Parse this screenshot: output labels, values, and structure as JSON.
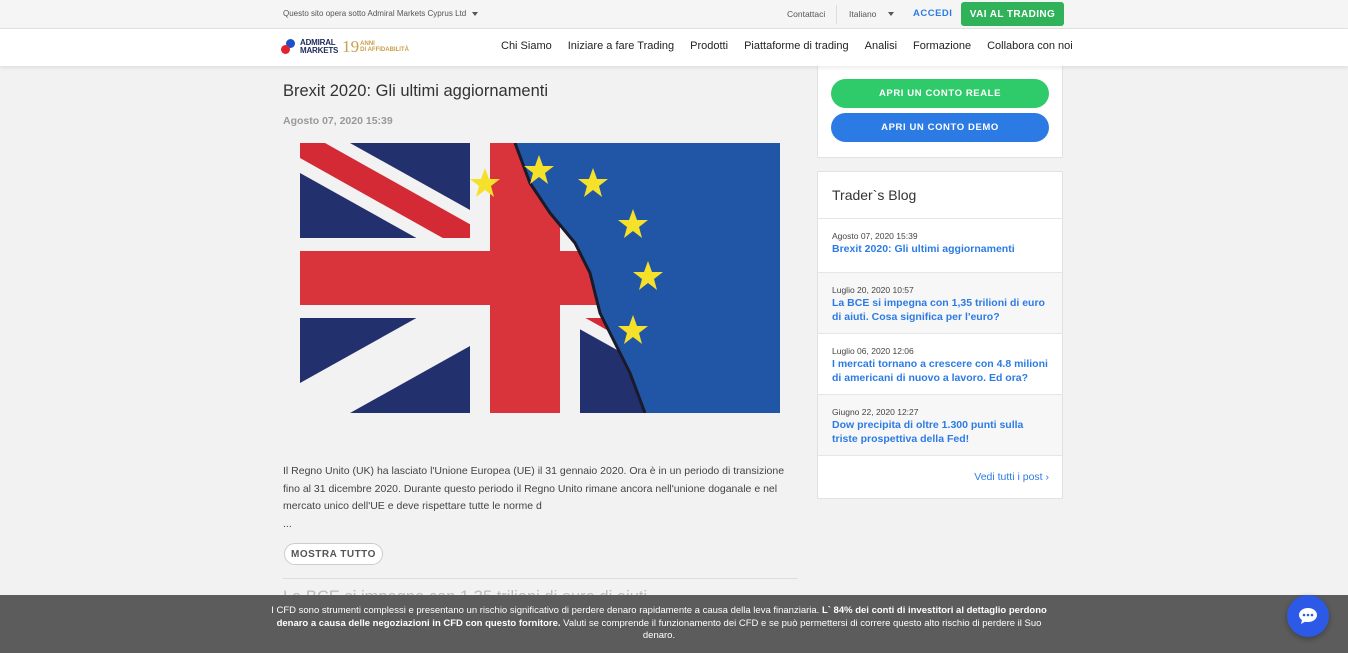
{
  "topbar": {
    "entity": "Questo sito opera sotto Admiral Markets Cyprus Ltd",
    "contact": "Contattaci",
    "language": "Italiano",
    "login": "ACCEDI",
    "trade_button": "VAI AL TRADING"
  },
  "logo": {
    "line1": "ADMIRAL",
    "line2": "MARKETS",
    "years": "19",
    "anni1": "ANNI",
    "anni2": "DI AFFIDABILITÀ"
  },
  "nav": {
    "items": [
      "Chi Siamo",
      "Iniziare a fare Trading",
      "Prodotti",
      "Piattaforme di trading",
      "Analisi",
      "Formazione",
      "Collabora con noi"
    ]
  },
  "article": {
    "title": "Brexit 2020: Gli ultimi aggiornamenti",
    "date": "Agosto 07, 2020 15:39",
    "body": "Il Regno Unito (UK) ha lasciato l'Unione Europea (UE) il 31 gennaio 2020. Ora è in un periodo di transizione fino al 31 dicembre 2020. Durante questo periodo il Regno Unito rimane ancora nell'unione doganale e nel mercato unico dell'UE e deve rispettare tutte le norme d",
    "ellipsis": "...",
    "show_all": "MOSTRA TUTTO",
    "next_title_partial": "La BCE si impegna con 1,35 trilioni di euro di aiuti"
  },
  "sidebar": {
    "cta_real": "APRI UN CONTO REALE",
    "cta_demo": "APRI UN CONTO DEMO",
    "blog_title": "Trader`s Blog",
    "blog_items": [
      {
        "date": "Agosto 07, 2020 15:39",
        "title": "Brexit 2020: Gli ultimi aggiornamenti"
      },
      {
        "date": "Luglio 20, 2020 10:57",
        "title": "La BCE si impegna con 1,35 trilioni di euro di aiuti. Cosa significa per l'euro?"
      },
      {
        "date": "Luglio 06, 2020 12:06",
        "title": "I mercati tornano a crescere con 4.8 milioni di americani di nuovo a lavoro. Ed ora?"
      },
      {
        "date": "Giugno 22, 2020 12:27",
        "title": "Dow precipita di oltre 1.300 punti sulla triste prospettiva della Fed!"
      }
    ],
    "blog_all": "Vedi tutti i post ›"
  },
  "risk": {
    "part1": "I CFD sono strumenti complessi e presentano un rischio significativo di perdere denaro rapidamente a causa della leva finanziaria. ",
    "part2_bold": "L` 84% dei conti di investitori al dettaglio perdono denaro a causa delle negoziazioni in CFD con questo fornitore.",
    "part3": " Valuti se comprende il funzionamento dei CFD e se può permettersi di correre questo alto rischio di perdere il Suo denaro."
  },
  "colors": {
    "green": "#2fb25a",
    "cta_green": "#2fcb6a",
    "blue": "#2c7be5",
    "risk_bg": "#5c5c5c",
    "chat": "#2c5ae6"
  },
  "icons": [
    "chevron-down-icon",
    "chat-icon",
    "eu-star-icon"
  ]
}
